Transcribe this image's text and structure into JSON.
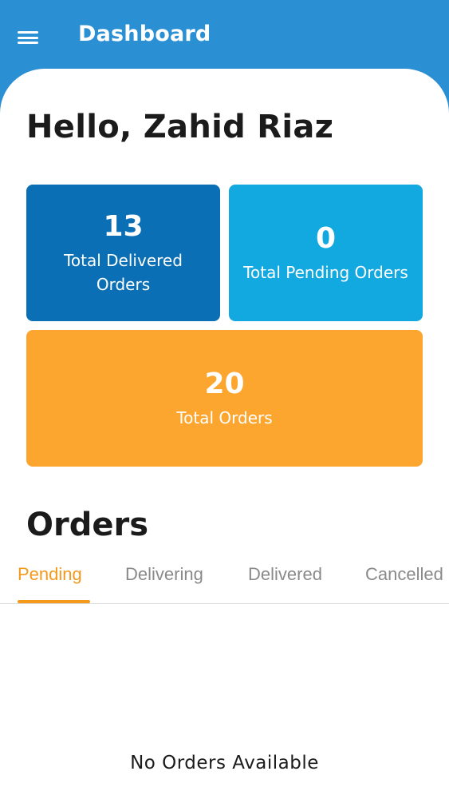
{
  "appbar": {
    "title": "Dashboard",
    "menu_icon": "hamburger-menu-icon",
    "color": "#2a8fd3"
  },
  "greeting": "Hello, Zahid Riaz",
  "stats": {
    "delivered": {
      "value": "13",
      "label": "Total Delivered Orders",
      "color": "#0a6fb5"
    },
    "pending": {
      "value": "0",
      "label": "Total Pending Orders",
      "color": "#12a8e0"
    },
    "total": {
      "value": "20",
      "label": "Total Orders",
      "color": "#fca630"
    }
  },
  "orders": {
    "title": "Orders",
    "tabs": [
      "Pending",
      "Delivering",
      "Delivered",
      "Cancelled"
    ],
    "active_tab": "Pending",
    "accent": "#f39a1d",
    "empty_message": "No Orders Available"
  }
}
